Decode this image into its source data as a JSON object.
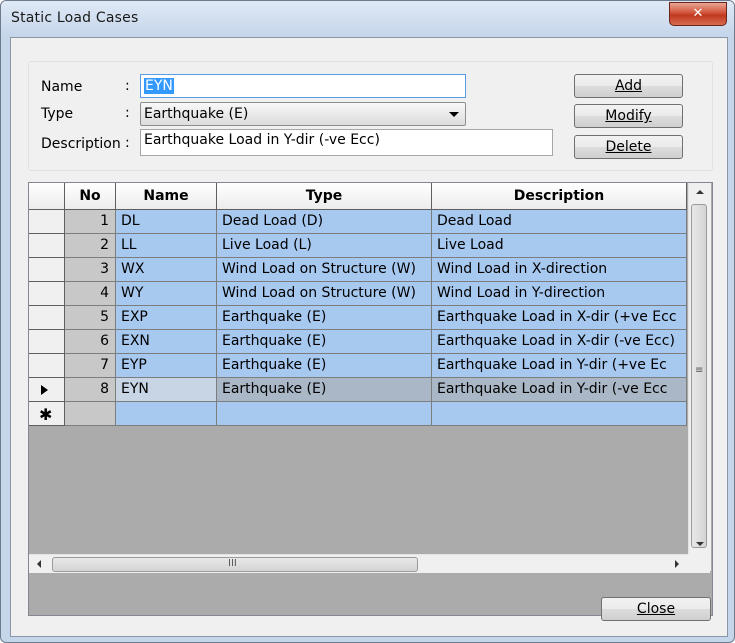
{
  "window": {
    "title": "Static Load Cases",
    "close_glyph": "✕"
  },
  "form": {
    "name_label": "Name",
    "name_value": "EYN",
    "type_label": "Type",
    "type_value": "Earthquake (E)",
    "description_label": "Description",
    "description_value": "Earthquake Load in Y-dir (-ve Ecc)",
    "colon": ":"
  },
  "buttons": {
    "add": "Add",
    "modify": "Modify",
    "delete": "Delete",
    "close": "Close"
  },
  "table": {
    "columns": [
      "No",
      "Name",
      "Type",
      "Description"
    ],
    "rows": [
      {
        "no": "1",
        "name": "DL",
        "type": "Dead Load (D)",
        "description": "Dead Load"
      },
      {
        "no": "2",
        "name": "LL",
        "type": "Live Load (L)",
        "description": "Live Load"
      },
      {
        "no": "3",
        "name": "WX",
        "type": "Wind Load on Structure (W)",
        "description": "Wind Load in X-direction"
      },
      {
        "no": "4",
        "name": "WY",
        "type": "Wind Load on Structure (W)",
        "description": "Wind Load in Y-direction"
      },
      {
        "no": "5",
        "name": "EXP",
        "type": "Earthquake (E)",
        "description": "Earthquake Load in X-dir (+ve Ecc"
      },
      {
        "no": "6",
        "name": "EXN",
        "type": "Earthquake (E)",
        "description": "Earthquake Load in X-dir (-ve Ecc)"
      },
      {
        "no": "7",
        "name": "EYP",
        "type": "Earthquake (E)",
        "description": "Earthquake Load in Y-dir (+ve Ec"
      },
      {
        "no": "8",
        "name": "EYN",
        "type": "Earthquake (E)",
        "description": "Earthquake Load in Y-dir (-ve Ecc"
      }
    ],
    "new_row_glyph": "✱",
    "selected_row": 8
  },
  "scrollbars": {
    "vertical_grip": "≡",
    "horizontal_grip": "III"
  }
}
